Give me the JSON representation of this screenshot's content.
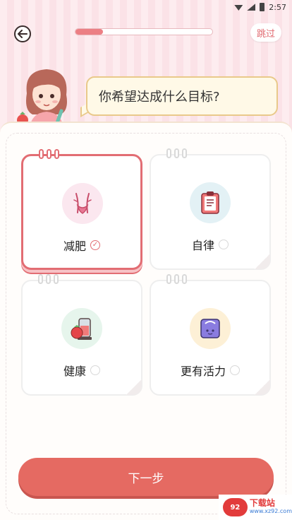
{
  "status": {
    "time": "2:57"
  },
  "header": {
    "skip_label": "跳过",
    "progress": 0.2
  },
  "question": "你希望达成什么目标?",
  "options": [
    {
      "label": "减肥",
      "selected": true,
      "icon": "waist-icon",
      "icon_bg": "#fbe7ef"
    },
    {
      "label": "自律",
      "selected": false,
      "icon": "clipboard-icon",
      "icon_bg": "#e3f1f5"
    },
    {
      "label": "健康",
      "selected": false,
      "icon": "juicer-strawberry-icon",
      "icon_bg": "#e6f5ec"
    },
    {
      "label": "更有活力",
      "selected": false,
      "icon": "scale-icon",
      "icon_bg": "#fdf0d6"
    }
  ],
  "next_label": "下一步",
  "watermark": {
    "logo": "92",
    "text": "下载站",
    "sub": "www.xz92.com"
  },
  "colors": {
    "accent": "#e56a62",
    "selected_border": "#e26d73"
  }
}
